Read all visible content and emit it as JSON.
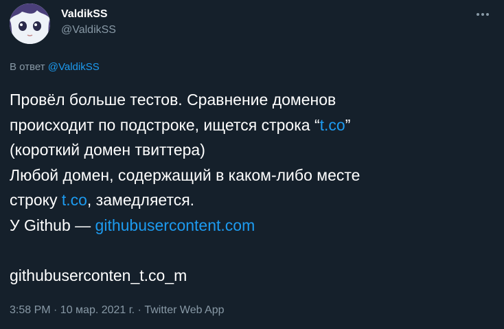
{
  "author": {
    "name": "ValdikSS",
    "handle": "@ValdikSS"
  },
  "reply": {
    "prefix": "В ответ",
    "mention": "@ValdikSS"
  },
  "tweet": {
    "line1": "Провёл больше тестов. Сравнение доменов",
    "line2_before": "происходит по подстроке, ищется строка “",
    "line2_link": "t.co",
    "line2_after": "”",
    "line3": "(короткий домен твиттера)",
    "line4": "Любой домен, содержащий в каком-либо месте",
    "line5_before": "строку ",
    "line5_link": "t.co",
    "line5_after": ", замедляется.",
    "line6_before": "У Github — ",
    "line6_link": "githubusercontent.com",
    "line8": "githubuserconten_t.co_m"
  },
  "meta": {
    "timestamp": "3:58 PM · 10 мар. 2021 г. · Twitter Web App"
  },
  "colors": {
    "background": "#15202b",
    "text": "#ffffff",
    "secondary": "#8899a6",
    "link": "#1d9bf0"
  },
  "icons": {
    "more": "more-horizontal-icon",
    "avatar": "anime-character-avatar"
  }
}
